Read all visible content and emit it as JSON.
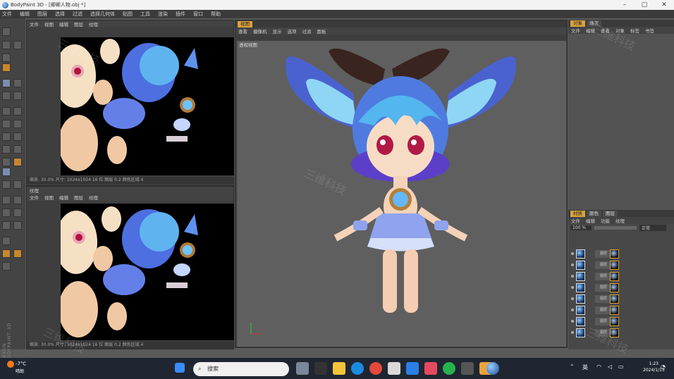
{
  "window": {
    "title": "BodyPaint 3D - [卿卿人物.obj *]",
    "minimize": "–",
    "maximize": "▢",
    "close": "✕"
  },
  "menu": [
    "文件",
    "编辑",
    "图层",
    "选择",
    "过滤",
    "选择几何体",
    "贴图",
    "工具",
    "渲染",
    "插件",
    "窗口",
    "帮助"
  ],
  "texture_panel_top": {
    "menus": [
      "文件",
      "视图",
      "编辑",
      "图层",
      "纹理"
    ],
    "status": "缩放: 30.0%  尺寸: 1024x1024  16 位  图层  0.2  颜色区域 4"
  },
  "texture_panel_bottom": {
    "title": "纹理",
    "menus": [
      "文件",
      "视图",
      "编辑",
      "图层",
      "纹理"
    ],
    "status": "缩放: 30.0%  尺寸: 1024x1024  16 位  图层  0.2  颜色区域 4"
  },
  "viewport": {
    "tab": "视图",
    "menus": [
      "查看",
      "摄像机",
      "显示",
      "选项",
      "过滤",
      "面板"
    ],
    "label": "透视视图"
  },
  "right_panel": {
    "tabs": [
      "对象",
      "场次"
    ],
    "menus": [
      "文件",
      "编辑",
      "查看",
      "对象",
      "标签",
      "书签"
    ]
  },
  "layers_panel": {
    "tabs": [
      "材质",
      "颜色",
      "图层"
    ],
    "menus": [
      "文件",
      "编辑",
      "功能",
      "纹理"
    ],
    "zoom": "100 %",
    "blend": "正常",
    "rows": [
      "图层",
      "图层",
      "图层",
      "图层",
      "图层",
      "图层",
      "图层",
      "图层"
    ]
  },
  "maxon": "MAXON BODYPAINT 3D",
  "watermarks": [
    "三维科技",
    "三维科技",
    "三维科技",
    "三维科技",
    "三维科技"
  ],
  "taskbar": {
    "temperature": "-7°C",
    "weather": "晴朗",
    "search_placeholder": "搜索",
    "lang": "英",
    "time": "1:23",
    "date": "2024/1/15"
  },
  "colors": {
    "accent": "#d8a23c",
    "panel_bg": "#3e3e3e",
    "viewport_bg": "#5f5f5f",
    "taskbar": "#1f2631"
  }
}
